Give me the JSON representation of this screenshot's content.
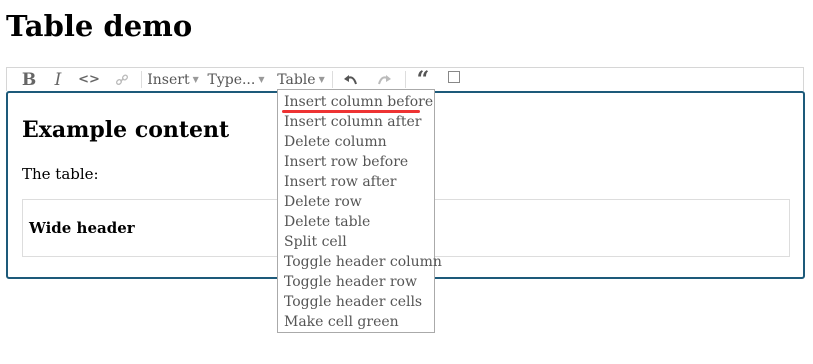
{
  "page": {
    "title": "Table demo"
  },
  "menubar": {
    "bold": "B",
    "italic": "I",
    "code": "<>",
    "insert": "Insert",
    "type": "Type...",
    "table": "Table",
    "quote": "“"
  },
  "editor": {
    "heading": "Example content",
    "paragraph": "The table:",
    "table_header": "Wide header"
  },
  "table_menu": {
    "items": [
      "Insert column before",
      "Insert column after",
      "Delete column",
      "Insert row before",
      "Insert row after",
      "Delete row",
      "Delete table",
      "Split cell",
      "Toggle header column",
      "Toggle header row",
      "Toggle header cells",
      "Make cell green"
    ]
  },
  "colors": {
    "editor_border": "#1d5a7a",
    "highlight_underline": "#e33333"
  }
}
